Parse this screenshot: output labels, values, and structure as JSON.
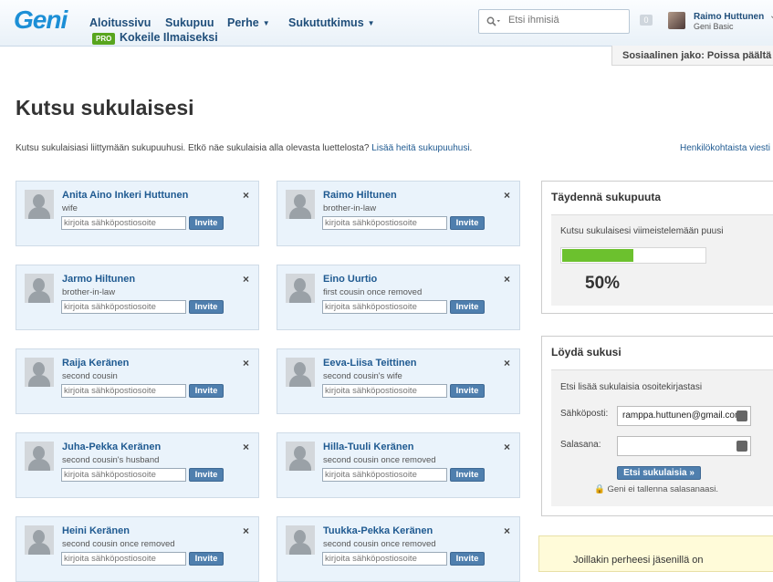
{
  "header": {
    "logo": "Geni",
    "nav": [
      {
        "label": "Aloitussivu",
        "dropdown": false
      },
      {
        "label": "Sukupuu",
        "dropdown": false
      },
      {
        "label": "Perhe",
        "dropdown": true
      },
      {
        "label": "Sukututkimus",
        "dropdown": true
      }
    ],
    "pro_badge": "PRO",
    "trial_link": "Kokeile Ilmaiseksi",
    "search_placeholder": "Etsi ihmisiä",
    "notification_count": "0",
    "user_name": "Raimo Huttunen",
    "user_plan": "Geni Basic"
  },
  "social_share": "Sosiaalinen jako: Poissa päältä",
  "page": {
    "title": "Kutsu sukulaisesi",
    "intro_text": "Kutsu sukulaisiasi liittymään sukupuuhusi. Etkö näe sukulaisia alla olevasta luettelosta?",
    "intro_link": "Lisää heitä sukupuuhusi",
    "intro_end": ".",
    "personal_link": "Henkilökohtaista viesti"
  },
  "invite_form": {
    "email_placeholder": "kirjoita sähköpostiosoite",
    "invite_label": "Invite",
    "remove_label": "×"
  },
  "relatives": [
    {
      "name": "Anita Aino Inkeri Huttunen",
      "relation": "wife"
    },
    {
      "name": "Raimo Hiltunen",
      "relation": "brother-in-law"
    },
    {
      "name": "Jarmo Hiltunen",
      "relation": "brother-in-law"
    },
    {
      "name": "Eino Uurtio",
      "relation": "first cousin once removed"
    },
    {
      "name": "Raija Keränen",
      "relation": "second cousin"
    },
    {
      "name": "Eeva-Liisa Teittinen",
      "relation": "second cousin's wife"
    },
    {
      "name": "Juha-Pekka Keränen",
      "relation": "second cousin's husband"
    },
    {
      "name": "Hilla-Tuuli Keränen",
      "relation": "second cousin once removed"
    },
    {
      "name": "Heini Keränen",
      "relation": "second cousin once removed"
    },
    {
      "name": "Tuukka-Pekka Keränen",
      "relation": "second cousin once removed"
    }
  ],
  "complete_tree": {
    "title": "Täydennä sukupuuta",
    "description": "Kutsu sukulaisesi viimeistelemään puusi",
    "progress": 0.5,
    "progress_label": "50%"
  },
  "find_relatives": {
    "title": "Löydä sukusi",
    "description": "Etsi lisää sukulaisia osoitekirjastasi",
    "email_label": "Sähköposti:",
    "email_value": "ramppa.huttunen@gmail.com",
    "password_label": "Salasana:",
    "password_value": "",
    "button": "Etsi sukulaisia »",
    "security_note": "Geni ei tallenna salasanaasi."
  },
  "notice": "Joillakin perheesi jäsenillä on",
  "colors": {
    "link": "#1f5a91",
    "progress": "#6cc12e",
    "button": "#4f7fae",
    "card": "#eaf3fb"
  }
}
